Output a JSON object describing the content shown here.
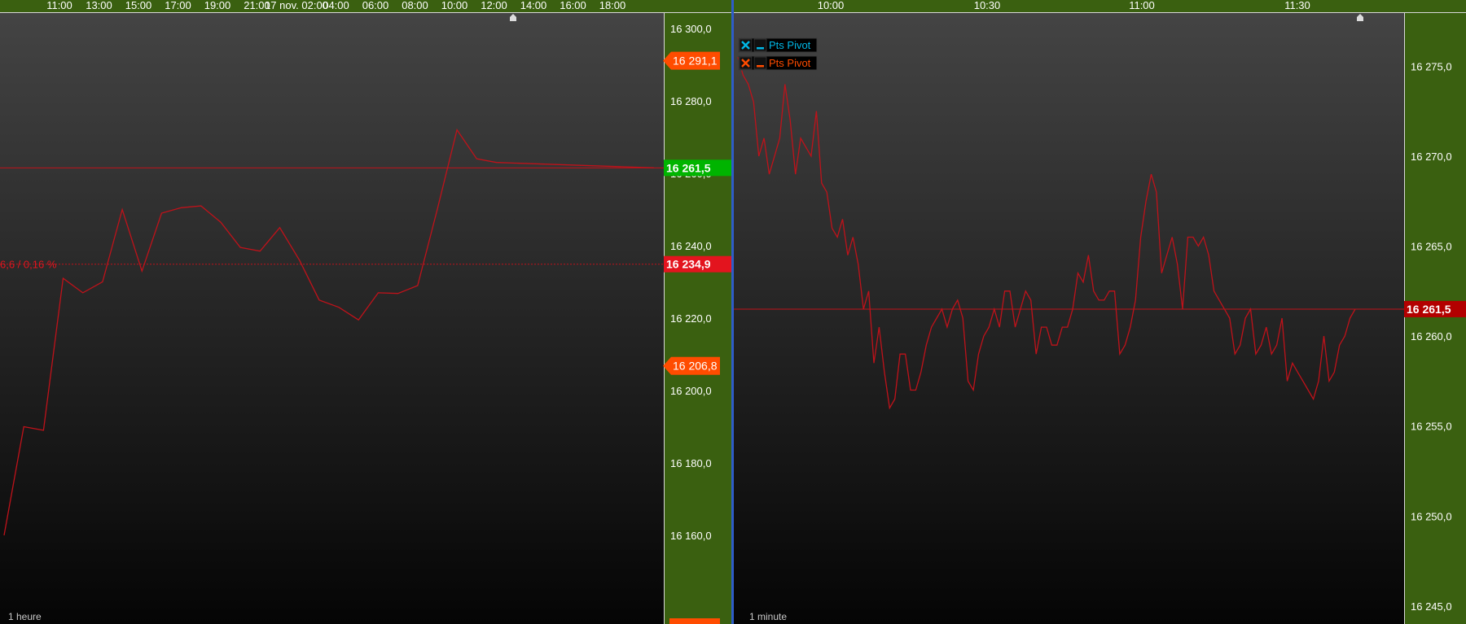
{
  "colors": {
    "axis_bg": "#3a6010",
    "plot_top": "#444444",
    "plot_bottom": "#050505",
    "line": "#c0121a",
    "divider": "#2e5cc8",
    "badge_green": "#00b400",
    "badge_red": "#e3141e",
    "badge_darkred": "#b30000",
    "badge_orange": "#ff4c00",
    "legend_cyan": "#00b7e6",
    "legend_orange": "#ff4c00"
  },
  "chart_data": [
    {
      "type": "line",
      "timeframe_label": "1 heure",
      "x_tick_labels": [
        "11:00",
        "13:00",
        "15:00",
        "17:00",
        "19:00",
        "21:00",
        "17 nov. 02:00",
        "04:00",
        "06:00",
        "08:00",
        "10:00",
        "12:00",
        "14:00",
        "16:00",
        "18:00"
      ],
      "y_tick_labels": [
        "16 300,0",
        "16 280,0",
        "16 260,0",
        "16 240,0",
        "16 220,0",
        "16 200,0",
        "16 180,0",
        "16 160,0"
      ],
      "ylim": [
        16135.5,
        16304.5
      ],
      "values": [
        16160.0,
        16190.0,
        16189.0,
        16231.0,
        16227.0,
        16230.0,
        16250.0,
        16233.0,
        16249.0,
        16250.5,
        16251.0,
        16246.5,
        16239.5,
        16238.5,
        16245.0,
        16236.0,
        16225.0,
        16223.0,
        16219.5,
        16227.0,
        16226.8,
        16229.0,
        16250.0,
        16272.0,
        16264.0,
        16263.0,
        16261.5
      ],
      "x_positions": [
        0,
        1,
        2,
        3,
        4,
        5,
        6,
        7,
        8,
        9,
        10,
        11,
        12,
        13,
        14,
        15,
        16,
        17,
        18,
        19,
        20,
        21,
        22,
        23,
        24,
        25,
        33
      ],
      "x_range": [
        0,
        33.5
      ],
      "horizontal_levels": [
        {
          "value": 16261.5,
          "style": "solid",
          "badge": "16 261,5",
          "badge_color": "green"
        },
        {
          "value": 16234.9,
          "style": "dotted",
          "badge": "16 234,9",
          "badge_color": "red",
          "annotation": "6,6 / 0,16 %"
        }
      ],
      "price_markers": [
        {
          "value": 16291.1,
          "label": "16 291,1"
        },
        {
          "value": 16206.8,
          "label": "16 206,8"
        }
      ]
    },
    {
      "type": "line",
      "timeframe_label": "1 minute",
      "x_tick_labels": [
        "10:00",
        "10:30",
        "11:00",
        "11:30"
      ],
      "y_tick_labels": [
        "16 275,0",
        "16 270,0",
        "16 265,0",
        "16 260,0",
        "16 255,0",
        "16 250,0",
        "16 245,0"
      ],
      "ylim": [
        16244.0,
        16278.0
      ],
      "legend": [
        {
          "label": "Pts Pivot",
          "color": "cyan"
        },
        {
          "label": "Pts Pivot",
          "color": "orange"
        }
      ],
      "horizontal_levels": [
        {
          "value": 16261.5,
          "style": "solid",
          "badge": "16 261,5",
          "badge_color": "darkred"
        }
      ],
      "values": [
        16275.5,
        16274.5,
        16274.0,
        16273.0,
        16270.0,
        16271.0,
        16269.0,
        16270.0,
        16271.0,
        16274.0,
        16272.0,
        16269.0,
        16271.0,
        16270.5,
        16270.0,
        16272.5,
        16268.5,
        16268.0,
        16266.0,
        16265.5,
        16266.5,
        16264.5,
        16265.5,
        16264.0,
        16261.5,
        16262.5,
        16258.5,
        16260.5,
        16258.0,
        16256.0,
        16256.5,
        16259.0,
        16259.0,
        16257.0,
        16257.0,
        16258.0,
        16259.5,
        16260.5,
        16261.0,
        16261.5,
        16260.5,
        16261.5,
        16262.0,
        16261.0,
        16257.5,
        16257.0,
        16259.0,
        16260.0,
        16260.5,
        16261.5,
        16260.5,
        16262.5,
        16262.5,
        16260.5,
        16261.5,
        16262.5,
        16262.0,
        16259.0,
        16260.5,
        16260.5,
        16259.5,
        16259.5,
        16260.5,
        16260.5,
        16261.5,
        16263.5,
        16263.0,
        16264.5,
        16262.5,
        16262.0,
        16262.0,
        16262.5,
        16262.5,
        16259.0,
        16259.5,
        16260.5,
        16262.0,
        16265.5,
        16267.5,
        16269.0,
        16268.0,
        16263.5,
        16264.5,
        16265.5,
        16264.0,
        16261.5,
        16265.5,
        16265.5,
        16265.0,
        16265.5,
        16264.5,
        16262.5,
        16262.0,
        16261.5,
        16261.0,
        16259.0,
        16259.5,
        16261.0,
        16261.5,
        16259.0,
        16259.5,
        16260.5,
        16259.0,
        16259.5,
        16261.0,
        16257.5,
        16258.5,
        16258.0,
        16257.5,
        16257.0,
        16256.5,
        16257.5,
        16260.0,
        16257.5,
        16258.0,
        16259.5,
        16260.0,
        16261.0,
        16261.5
      ]
    }
  ]
}
